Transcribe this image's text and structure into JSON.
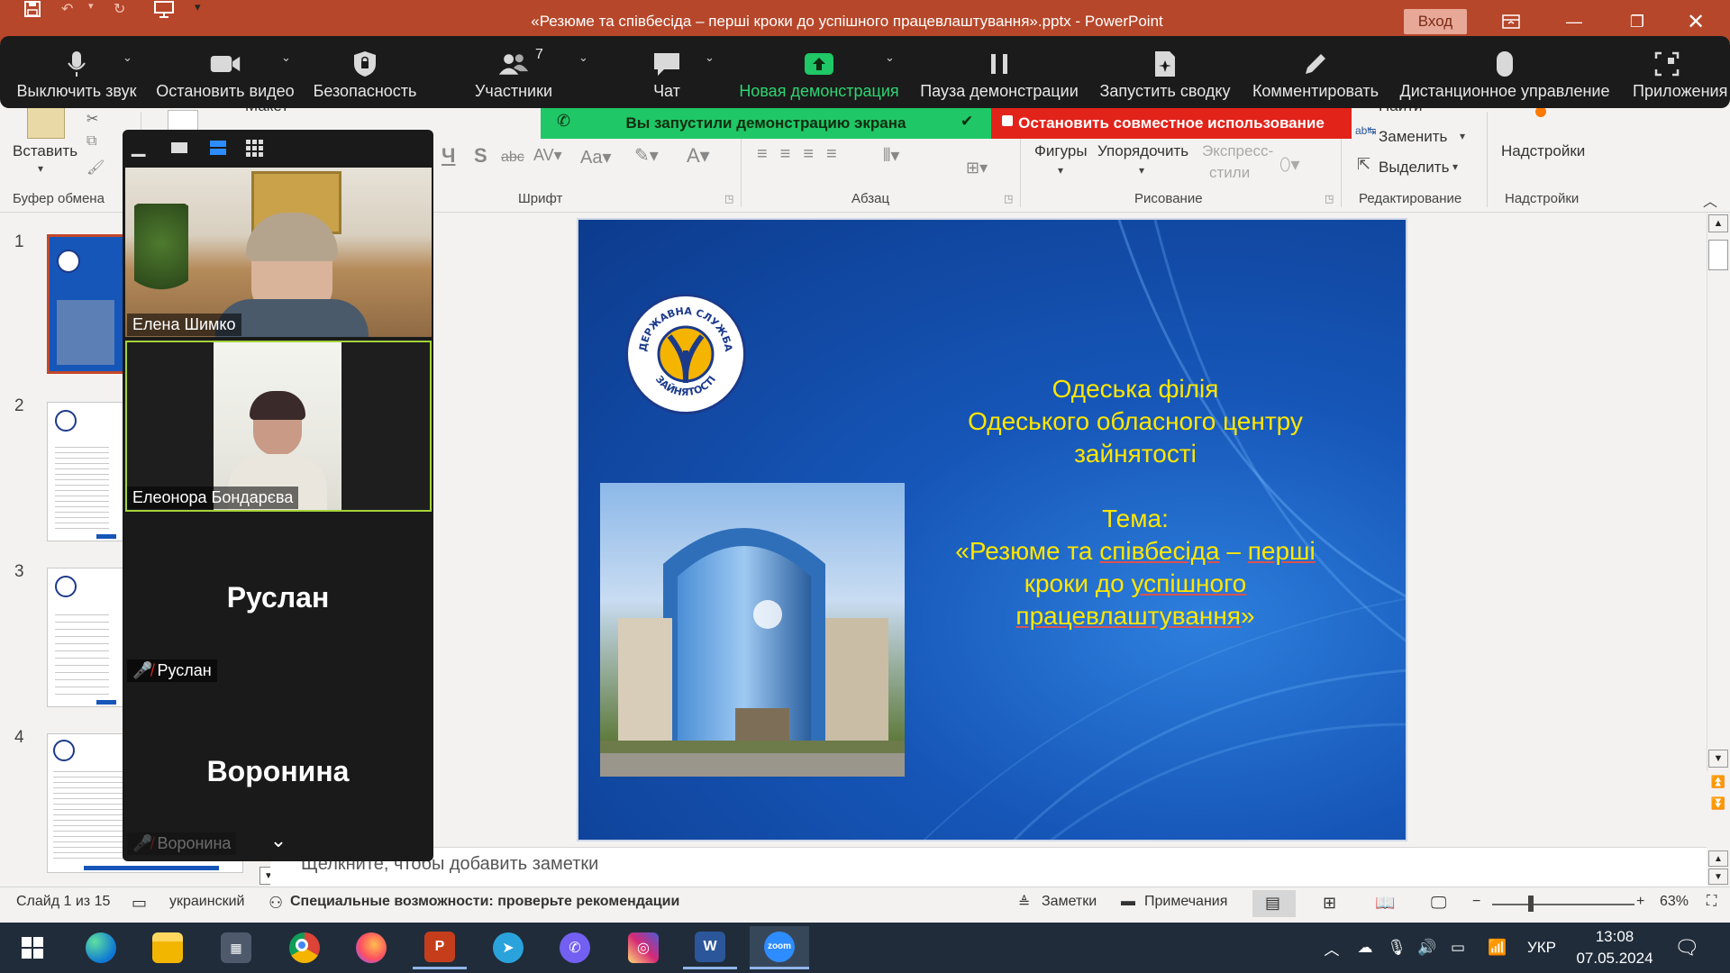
{
  "window": {
    "title": "«Резюме та співбесіда – перші кроки до успішного працевлаштування».pptx  -  PowerPoint",
    "login_label": "Вход"
  },
  "zoom_toolbar": {
    "participants_count": "7",
    "items": [
      {
        "label": "Выключить звук",
        "icon": "microphone-icon"
      },
      {
        "label": "Остановить видео",
        "icon": "video-camera-icon"
      },
      {
        "label": "Безопасность",
        "icon": "shield-icon"
      },
      {
        "label": "Участники",
        "icon": "participants-icon"
      },
      {
        "label": "Чат",
        "icon": "chat-icon"
      },
      {
        "label": "Новая демонстрация",
        "icon": "share-screen-icon"
      },
      {
        "label": "Пауза демонстрации",
        "icon": "pause-icon"
      },
      {
        "label": "Запустить сводку",
        "icon": "summary-icon"
      },
      {
        "label": "Комментировать",
        "icon": "pen-icon"
      },
      {
        "label": "Дистанционное управление",
        "icon": "mouse-icon"
      },
      {
        "label": "Приложения",
        "icon": "apps-icon"
      }
    ],
    "share_banner": "Вы запустили демонстрацию экрана",
    "stop_share": "Остановить совместное использование"
  },
  "ribbon": {
    "clipboard": {
      "paste": "Вставить",
      "group": "Буфер обмена"
    },
    "layout_label": "Макет",
    "font_group": "Шрифт",
    "paragraph_group": "Абзац",
    "drawing": {
      "shapes": "Фигуры",
      "arrange": "Упорядочить",
      "quick_styles_1": "Экспресс-",
      "quick_styles_2": "стили",
      "group": "Рисование"
    },
    "editing": {
      "find": "Найти",
      "replace": "Заменить",
      "select": "Выделить",
      "group": "Редактирование"
    },
    "addins": {
      "button": "Надстройки",
      "group": "Надстройки"
    }
  },
  "thumbnails": [
    {
      "num": "1",
      "selected": true
    },
    {
      "num": "2",
      "selected": false
    },
    {
      "num": "3",
      "selected": false
    },
    {
      "num": "4",
      "selected": false
    }
  ],
  "slide": {
    "logo_text": "ДЕРЖАВНА СЛУЖБА ЗАЙНЯТОСТІ",
    "org_line1": "Одеська філія",
    "org_line2": "Одеського обласного центру",
    "org_line3": "зайнятості",
    "topic_label": "Тема:",
    "topic_line1a": "«Резюме та ",
    "topic_line1b": "співбесіда",
    "topic_line1c": " – ",
    "topic_line1d": "перші",
    "topic_line2a": "кроки до ",
    "topic_line2b": "успішного",
    "topic_line3": "працевлаштування",
    "topic_line3_end": "»"
  },
  "notes_placeholder": "Щелкните, чтобы добавить заметки",
  "gallery": {
    "participants": [
      {
        "name": "Елена Шимко"
      },
      {
        "name": "Елеонора Бондарєва"
      },
      {
        "name": "Руслан"
      },
      {
        "name": "Воронина"
      }
    ]
  },
  "status": {
    "slide_info": "Слайд 1 из 15",
    "language": "украинский",
    "accessibility": "Специальные возможности: проверьте рекомендации",
    "notes": "Заметки",
    "comments": "Примечания",
    "zoom": "63%"
  },
  "taskbar": {
    "apps": [
      {
        "name": "windows-start-icon"
      },
      {
        "name": "edge-icon"
      },
      {
        "name": "file-explorer-icon"
      },
      {
        "name": "calculator-icon"
      },
      {
        "name": "chrome-icon"
      },
      {
        "name": "firefox-icon"
      },
      {
        "name": "powerpoint-icon"
      },
      {
        "name": "telegram-icon"
      },
      {
        "name": "viber-icon"
      },
      {
        "name": "instagram-icon"
      },
      {
        "name": "word-icon"
      },
      {
        "name": "zoom-icon"
      }
    ],
    "zoom_label": "zoom",
    "lang": "УКР",
    "time": "13:08",
    "date": "07.05.2024"
  },
  "colors": {
    "title_bar": "#b7472a",
    "zoom_bar": "#1b1b1b",
    "share_green": "#1fc766",
    "stop_red": "#e2231a",
    "slide_text": "#ffe600",
    "slide_blue": "#1656b8"
  }
}
